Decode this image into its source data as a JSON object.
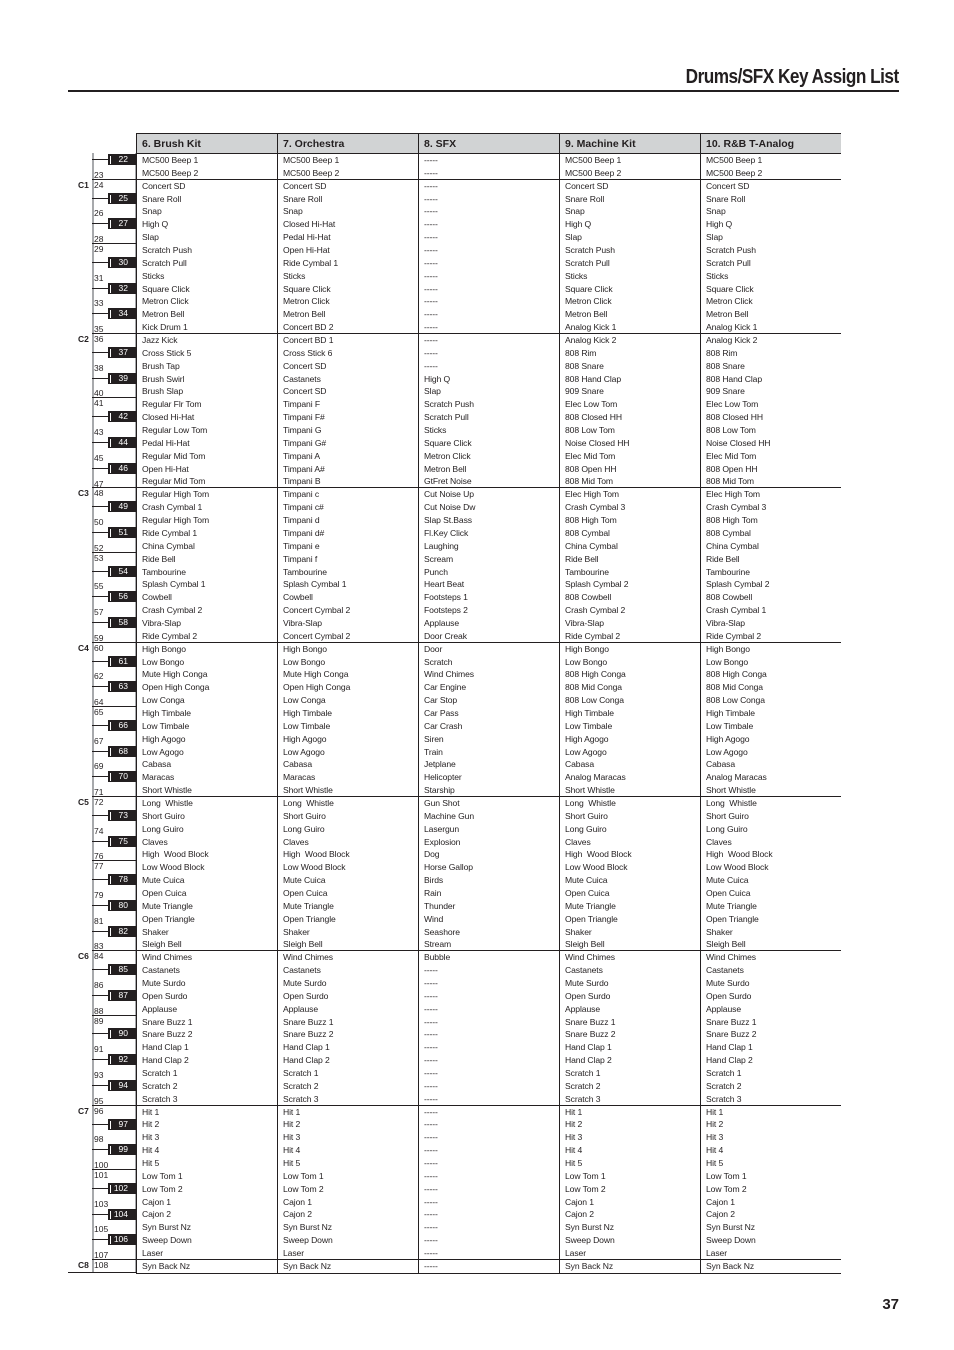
{
  "header": {
    "title": "Drums/SFX Key Assign List"
  },
  "footer": {
    "page_number": "37"
  },
  "table": {
    "columns": [
      "6. Brush Kit",
      "7. Orchestra",
      "8. SFX",
      "9. Machine Kit",
      "10. R&B T-Analog"
    ],
    "octave_labels": [
      {
        "key": 24,
        "label": "C1"
      },
      {
        "key": 36,
        "label": "C2"
      },
      {
        "key": 48,
        "label": "C3"
      },
      {
        "key": 60,
        "label": "C4"
      },
      {
        "key": 72,
        "label": "C5"
      },
      {
        "key": 84,
        "label": "C6"
      },
      {
        "key": 96,
        "label": "C7"
      },
      {
        "key": 108,
        "label": "C8"
      }
    ],
    "rows": [
      {
        "key": 22,
        "values": [
          "MC500 Beep 1",
          "MC500 Beep 1",
          "-----",
          "MC500 Beep 1",
          "MC500 Beep 1"
        ]
      },
      {
        "key": 23,
        "values": [
          "MC500 Beep 2",
          "MC500 Beep 2",
          "-----",
          "MC500 Beep 2",
          "MC500 Beep 2"
        ]
      },
      {
        "key": 24,
        "values": [
          "Concert SD",
          "Concert SD",
          "-----",
          "Concert SD",
          "Concert SD"
        ]
      },
      {
        "key": 25,
        "values": [
          "Snare Roll",
          "Snare Roll",
          "-----",
          "Snare Roll",
          "Snare Roll"
        ]
      },
      {
        "key": 26,
        "values": [
          "Snap",
          "Snap",
          "-----",
          "Snap",
          "Snap"
        ]
      },
      {
        "key": 27,
        "values": [
          "High Q",
          "Closed Hi-Hat",
          "-----",
          "High Q",
          "High Q"
        ]
      },
      {
        "key": 28,
        "values": [
          "Slap",
          "Pedal Hi-Hat",
          "-----",
          "Slap",
          "Slap"
        ]
      },
      {
        "key": 29,
        "values": [
          "Scratch Push",
          "Open Hi-Hat",
          "-----",
          "Scratch Push",
          "Scratch Push"
        ]
      },
      {
        "key": 30,
        "values": [
          "Scratch Pull",
          "Ride Cymbal 1",
          "-----",
          "Scratch Pull",
          "Scratch Pull"
        ]
      },
      {
        "key": 31,
        "values": [
          "Sticks",
          "Sticks",
          "-----",
          "Sticks",
          "Sticks"
        ]
      },
      {
        "key": 32,
        "values": [
          "Square Click",
          "Square Click",
          "-----",
          "Square Click",
          "Square Click"
        ]
      },
      {
        "key": 33,
        "values": [
          "Metron Click",
          "Metron Click",
          "-----",
          "Metron Click",
          "Metron Click"
        ]
      },
      {
        "key": 34,
        "values": [
          "Metron Bell",
          "Metron Bell",
          "-----",
          "Metron Bell",
          "Metron Bell"
        ]
      },
      {
        "key": 35,
        "values": [
          "Kick Drum 1",
          "Concert BD 2",
          "-----",
          "Analog Kick 1",
          "Analog Kick 1"
        ]
      },
      {
        "key": 36,
        "values": [
          "Jazz Kick",
          "Concert BD 1",
          "-----",
          "Analog Kick 2",
          "Analog Kick 2"
        ]
      },
      {
        "key": 37,
        "values": [
          "Cross Stick 5",
          "Cross Stick 6",
          "-----",
          "808 Rim",
          "808 Rim"
        ]
      },
      {
        "key": 38,
        "values": [
          "Brush Tap",
          "Concert SD",
          "-----",
          "808 Snare",
          "808 Snare"
        ]
      },
      {
        "key": 39,
        "values": [
          "Brush Swirl",
          "Castanets",
          "High Q",
          "808 Hand Clap",
          "808 Hand Clap"
        ]
      },
      {
        "key": 40,
        "values": [
          "Brush Slap",
          "Concert SD",
          "Slap",
          "909 Snare",
          "909 Snare"
        ]
      },
      {
        "key": 41,
        "values": [
          "Regular Flr Tom",
          "Timpani F",
          "Scratch Push",
          "Elec Low Tom",
          "Elec Low Tom"
        ]
      },
      {
        "key": 42,
        "values": [
          "Closed Hi-Hat",
          "Timpani F#",
          "Scratch Pull",
          "808 Closed HH",
          "808 Closed HH"
        ]
      },
      {
        "key": 43,
        "values": [
          "Regular Low Tom",
          "Timpani G",
          "Sticks",
          "808 Low Tom",
          "808 Low Tom"
        ]
      },
      {
        "key": 44,
        "values": [
          "Pedal Hi-Hat",
          "Timpani G#",
          "Square Click",
          "Noise Closed HH",
          "Noise Closed HH"
        ]
      },
      {
        "key": 45,
        "values": [
          "Regular Mid Tom",
          "Timpani A",
          "Metron Click",
          "Elec Mid Tom",
          "Elec Mid Tom"
        ]
      },
      {
        "key": 46,
        "values": [
          "Open Hi-Hat",
          "Timpani A#",
          "Metron Bell",
          "808 Open HH",
          "808 Open HH"
        ]
      },
      {
        "key": 47,
        "values": [
          "Regular Mid Tom",
          "Timpani B",
          "GtFret Noise",
          "808 Mid Tom",
          "808 Mid Tom"
        ]
      },
      {
        "key": 48,
        "values": [
          "Regular High Tom",
          "Timpani c",
          "Cut Noise Up",
          "Elec High Tom",
          "Elec High Tom"
        ]
      },
      {
        "key": 49,
        "values": [
          "Crash Cymbal 1",
          "Timpani c#",
          "Cut Noise Dw",
          "Crash Cymbal 3",
          "Crash Cymbal 3"
        ]
      },
      {
        "key": 50,
        "values": [
          "Regular High Tom",
          "Timpani d",
          "Slap St.Bass",
          "808 High Tom",
          "808 High Tom"
        ]
      },
      {
        "key": 51,
        "values": [
          "Ride Cymbal 1",
          "Timpani d#",
          "Fl.Key Click",
          "808 Cymbal",
          "808 Cymbal"
        ]
      },
      {
        "key": 52,
        "values": [
          "China Cymbal",
          "Timpani e",
          "Laughing",
          "China Cymbal",
          "China Cymbal"
        ]
      },
      {
        "key": 53,
        "values": [
          "Ride Bell",
          "Timpani f",
          "Scream",
          "Ride Bell",
          "Ride Bell"
        ]
      },
      {
        "key": 54,
        "values": [
          "Tambourine",
          "Tambourine",
          "Punch",
          "Tambourine",
          "Tambourine"
        ]
      },
      {
        "key": 55,
        "values": [
          "Splash Cymbal 1",
          "Splash Cymbal 1",
          "Heart Beat",
          "Splash Cymbal 2",
          "Splash Cymbal 2"
        ]
      },
      {
        "key": 56,
        "values": [
          "Cowbell",
          "Cowbell",
          "Footsteps 1",
          "808 Cowbell",
          "808 Cowbell"
        ]
      },
      {
        "key": 57,
        "values": [
          "Crash Cymbal 2",
          "Concert Cymbal 2",
          "Footsteps 2",
          "Crash Cymbal 2",
          "Crash Cymbal 1"
        ]
      },
      {
        "key": 58,
        "values": [
          "Vibra-Slap",
          "Vibra-Slap",
          "Applause",
          "Vibra-Slap",
          "Vibra-Slap"
        ]
      },
      {
        "key": 59,
        "values": [
          "Ride Cymbal 2",
          "Concert Cymbal 2",
          "Door Creak",
          "Ride Cymbal 2",
          "Ride Cymbal 2"
        ]
      },
      {
        "key": 60,
        "values": [
          "High Bongo",
          "High Bongo",
          "Door",
          "High Bongo",
          "High Bongo"
        ]
      },
      {
        "key": 61,
        "values": [
          "Low Bongo",
          "Low Bongo",
          "Scratch",
          "Low Bongo",
          "Low Bongo"
        ]
      },
      {
        "key": 62,
        "values": [
          "Mute High Conga",
          "Mute High Conga",
          "Wind Chimes",
          "808 High Conga",
          "808 High Conga"
        ]
      },
      {
        "key": 63,
        "values": [
          "Open High Conga",
          "Open High Conga",
          "Car Engine",
          "808 Mid Conga",
          "808 Mid Conga"
        ]
      },
      {
        "key": 64,
        "values": [
          "Low Conga",
          "Low Conga",
          "Car Stop",
          "808 Low Conga",
          "808 Low Conga"
        ]
      },
      {
        "key": 65,
        "values": [
          "High Timbale",
          "High Timbale",
          "Car Pass",
          "High Timbale",
          "High Timbale"
        ]
      },
      {
        "key": 66,
        "values": [
          "Low Timbale",
          "Low Timbale",
          "Car Crash",
          "Low Timbale",
          "Low Timbale"
        ]
      },
      {
        "key": 67,
        "values": [
          "High Agogo",
          "High Agogo",
          "Siren",
          "High Agogo",
          "High Agogo"
        ]
      },
      {
        "key": 68,
        "values": [
          "Low Agogo",
          "Low Agogo",
          "Train",
          "Low Agogo",
          "Low Agogo"
        ]
      },
      {
        "key": 69,
        "values": [
          "Cabasa",
          "Cabasa",
          "Jetplane",
          "Cabasa",
          "Cabasa"
        ]
      },
      {
        "key": 70,
        "values": [
          "Maracas",
          "Maracas",
          "Helicopter",
          "Analog Maracas",
          "Analog Maracas"
        ]
      },
      {
        "key": 71,
        "values": [
          "Short Whistle",
          "Short Whistle",
          "Starship",
          "Short Whistle",
          "Short Whistle"
        ]
      },
      {
        "key": 72,
        "values": [
          "Long  Whistle",
          "Long  Whistle",
          "Gun Shot",
          "Long  Whistle",
          "Long  Whistle"
        ]
      },
      {
        "key": 73,
        "values": [
          "Short Guiro",
          "Short Guiro",
          "Machine Gun",
          "Short Guiro",
          "Short Guiro"
        ]
      },
      {
        "key": 74,
        "values": [
          "Long Guiro",
          "Long Guiro",
          "Lasergun",
          "Long Guiro",
          "Long Guiro"
        ]
      },
      {
        "key": 75,
        "values": [
          "Claves",
          "Claves",
          "Explosion",
          "Claves",
          "Claves"
        ]
      },
      {
        "key": 76,
        "values": [
          "High  Wood Block",
          "High  Wood Block",
          "Dog",
          "High  Wood Block",
          "High  Wood Block"
        ]
      },
      {
        "key": 77,
        "values": [
          "Low Wood Block",
          "Low Wood Block",
          "Horse Gallop",
          "Low Wood Block",
          "Low Wood Block"
        ]
      },
      {
        "key": 78,
        "values": [
          "Mute Cuica",
          "Mute Cuica",
          "Birds",
          "Mute Cuica",
          "Mute Cuica"
        ]
      },
      {
        "key": 79,
        "values": [
          "Open Cuica",
          "Open Cuica",
          "Rain",
          "Open Cuica",
          "Open Cuica"
        ]
      },
      {
        "key": 80,
        "values": [
          "Mute Triangle",
          "Mute Triangle",
          "Thunder",
          "Mute Triangle",
          "Mute Triangle"
        ]
      },
      {
        "key": 81,
        "values": [
          "Open Triangle",
          "Open Triangle",
          "Wind",
          "Open Triangle",
          "Open Triangle"
        ]
      },
      {
        "key": 82,
        "values": [
          "Shaker",
          "Shaker",
          "Seashore",
          "Shaker",
          "Shaker"
        ]
      },
      {
        "key": 83,
        "values": [
          "Sleigh Bell",
          "Sleigh Bell",
          "Stream",
          "Sleigh Bell",
          "Sleigh Bell"
        ]
      },
      {
        "key": 84,
        "values": [
          "Wind Chimes",
          "Wind Chimes",
          "Bubble",
          "Wind Chimes",
          "Wind Chimes"
        ]
      },
      {
        "key": 85,
        "values": [
          "Castanets",
          "Castanets",
          "-----",
          "Castanets",
          "Castanets"
        ]
      },
      {
        "key": 86,
        "values": [
          "Mute Surdo",
          "Mute Surdo",
          "-----",
          "Mute Surdo",
          "Mute Surdo"
        ]
      },
      {
        "key": 87,
        "values": [
          "Open Surdo",
          "Open Surdo",
          "-----",
          "Open Surdo",
          "Open Surdo"
        ]
      },
      {
        "key": 88,
        "values": [
          "Applause",
          "Applause",
          "-----",
          "Applause",
          "Applause"
        ]
      },
      {
        "key": 89,
        "values": [
          "Snare Buzz 1",
          "Snare Buzz 1",
          "-----",
          "Snare Buzz 1",
          "Snare Buzz 1"
        ]
      },
      {
        "key": 90,
        "values": [
          "Snare Buzz 2",
          "Snare Buzz 2",
          "-----",
          "Snare Buzz 2",
          "Snare Buzz 2"
        ]
      },
      {
        "key": 91,
        "values": [
          "Hand Clap 1",
          "Hand Clap 1",
          "-----",
          "Hand Clap 1",
          "Hand Clap 1"
        ]
      },
      {
        "key": 92,
        "values": [
          "Hand Clap 2",
          "Hand Clap 2",
          "-----",
          "Hand Clap 2",
          "Hand Clap 2"
        ]
      },
      {
        "key": 93,
        "values": [
          "Scratch 1",
          "Scratch 1",
          "-----",
          "Scratch 1",
          "Scratch 1"
        ]
      },
      {
        "key": 94,
        "values": [
          "Scratch 2",
          "Scratch 2",
          "-----",
          "Scratch 2",
          "Scratch 2"
        ]
      },
      {
        "key": 95,
        "values": [
          "Scratch 3",
          "Scratch 3",
          "-----",
          "Scratch 3",
          "Scratch 3"
        ]
      },
      {
        "key": 96,
        "values": [
          "Hit 1",
          "Hit 1",
          "-----",
          "Hit 1",
          "Hit 1"
        ]
      },
      {
        "key": 97,
        "values": [
          "Hit 2",
          "Hit 2",
          "-----",
          "Hit 2",
          "Hit 2"
        ]
      },
      {
        "key": 98,
        "values": [
          "Hit 3",
          "Hit 3",
          "-----",
          "Hit 3",
          "Hit 3"
        ]
      },
      {
        "key": 99,
        "values": [
          "Hit 4",
          "Hit 4",
          "-----",
          "Hit 4",
          "Hit 4"
        ]
      },
      {
        "key": 100,
        "values": [
          "Hit 5",
          "Hit 5",
          "-----",
          "Hit 5",
          "Hit 5"
        ]
      },
      {
        "key": 101,
        "values": [
          "Low Tom 1",
          "Low Tom 1",
          "-----",
          "Low Tom 1",
          "Low Tom 1"
        ]
      },
      {
        "key": 102,
        "values": [
          "Low Tom 2",
          "Low Tom 2",
          "-----",
          "Low Tom 2",
          "Low Tom 2"
        ]
      },
      {
        "key": 103,
        "values": [
          "Cajon 1",
          "Cajon 1",
          "-----",
          "Cajon 1",
          "Cajon 1"
        ]
      },
      {
        "key": 104,
        "values": [
          "Cajon 2",
          "Cajon 2",
          "-----",
          "Cajon 2",
          "Cajon 2"
        ]
      },
      {
        "key": 105,
        "values": [
          "Syn Burst Nz",
          "Syn Burst Nz",
          "-----",
          "Syn Burst Nz",
          "Syn Burst Nz"
        ]
      },
      {
        "key": 106,
        "values": [
          "Sweep Down",
          "Sweep Down",
          "-----",
          "Sweep Down",
          "Sweep Down"
        ]
      },
      {
        "key": 107,
        "values": [
          "Laser",
          "Laser",
          "-----",
          "Laser",
          "Laser"
        ]
      },
      {
        "key": 108,
        "values": [
          "Syn Back Nz",
          "Syn Back Nz",
          "-----",
          "Syn Back Nz",
          "Syn Back Nz"
        ]
      }
    ]
  }
}
